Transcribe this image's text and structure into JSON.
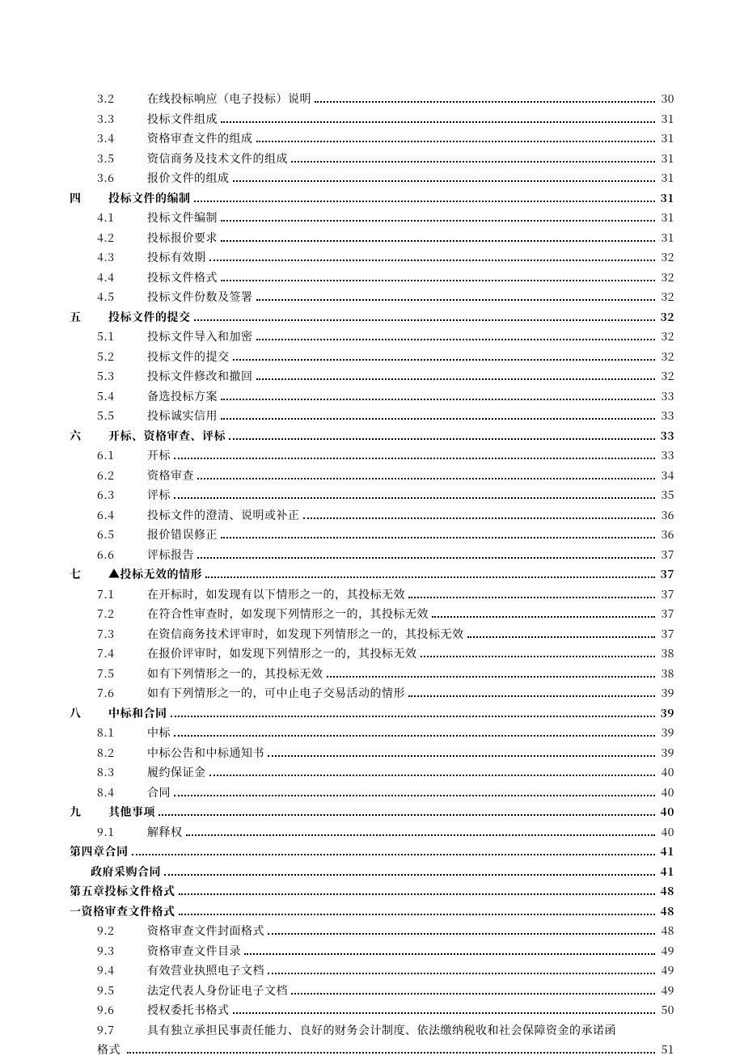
{
  "toc": [
    {
      "cls": "lvl-sub",
      "num": "3.2",
      "title": "在线投标响应（电子投标）说明",
      "page": "30"
    },
    {
      "cls": "lvl-sub",
      "num": "3.3",
      "title": "投标文件组成",
      "page": "31"
    },
    {
      "cls": "lvl-sub",
      "num": "3.4",
      "title": "资格审查文件的组成",
      "page": "31"
    },
    {
      "cls": "lvl-sub",
      "num": "3.5",
      "title": "资信商务及技术文件的组成",
      "page": "31"
    },
    {
      "cls": "lvl-sub",
      "num": "3.6",
      "title": "报价文件的组成",
      "page": "31"
    },
    {
      "cls": "lvl-sec",
      "num": "四",
      "title": "投标文件的编制 ",
      "page": "31"
    },
    {
      "cls": "lvl-sub",
      "num": "4.1",
      "title": "投标文件编制",
      "page": "31"
    },
    {
      "cls": "lvl-sub",
      "num": "4.2",
      "title": "投标报价要求",
      "page": "31"
    },
    {
      "cls": "lvl-sub",
      "num": "4.3",
      "title": "投标有效期",
      "page": "32"
    },
    {
      "cls": "lvl-sub",
      "num": "4.4",
      "title": "投标文件格式",
      "page": "32"
    },
    {
      "cls": "lvl-sub",
      "num": "4.5",
      "title": "投标文件份数及签署",
      "page": "32"
    },
    {
      "cls": "lvl-sec",
      "num": "五",
      "title": "投标文件的提交 ",
      "page": "32"
    },
    {
      "cls": "lvl-sub",
      "num": "5.1",
      "title": "投标文件导入和加密",
      "page": "32"
    },
    {
      "cls": "lvl-sub",
      "num": "5.2",
      "title": "投标文件的提交",
      "page": "32"
    },
    {
      "cls": "lvl-sub",
      "num": "5.3",
      "title": "投标文件修改和撤回",
      "page": "32"
    },
    {
      "cls": "lvl-sub",
      "num": "5.4",
      "title": "备选投标方案",
      "page": "33"
    },
    {
      "cls": "lvl-sub",
      "num": "5.5",
      "title": "投标诚实信用",
      "page": "33"
    },
    {
      "cls": "lvl-sec",
      "num": "六",
      "title": "开标、资格审查、评标 ",
      "page": "33"
    },
    {
      "cls": "lvl-sub",
      "num": "6.1",
      "title": "开标",
      "page": "33"
    },
    {
      "cls": "lvl-sub",
      "num": "6.2",
      "title": "资格审查",
      "page": "34"
    },
    {
      "cls": "lvl-sub",
      "num": "6.3",
      "title": "评标",
      "page": "35"
    },
    {
      "cls": "lvl-sub",
      "num": "6.4",
      "title": "投标文件的澄清、说明或补正",
      "page": "36"
    },
    {
      "cls": "lvl-sub",
      "num": "6.5",
      "title": "报价错误修正",
      "page": "36"
    },
    {
      "cls": "lvl-sub",
      "num": "6.6",
      "title": "评标报告",
      "page": "37"
    },
    {
      "cls": "lvl-sec",
      "num": "七",
      "title": "▲投标无效的情形 ",
      "page": "37"
    },
    {
      "cls": "lvl-sub",
      "num": "7.1",
      "title": "在开标时，如发现有以下情形之一的，其投标无效",
      "page": "37"
    },
    {
      "cls": "lvl-sub",
      "num": "7.2",
      "title": "在符合性审查时，如发现下列情形之一的，其投标无效",
      "page": "37"
    },
    {
      "cls": "lvl-sub",
      "num": "7.3",
      "title": "在资信商务技术评审时，如发现下列情形之一的，其投标无效",
      "page": "37"
    },
    {
      "cls": "lvl-sub",
      "num": "7.4",
      "title": "在报价评审时，如发现下列情形之一的，其投标无效",
      "page": "38"
    },
    {
      "cls": "lvl-sub",
      "num": "7.5",
      "title": "如有下列情形之一的，其投标无效",
      "page": "38"
    },
    {
      "cls": "lvl-sub",
      "num": "7.6",
      "title": "如有下列情形之一的，可中止电子交易活动的情形",
      "page": "39"
    },
    {
      "cls": "lvl-sec",
      "num": "八",
      "title": "中标和合同",
      "page": "39"
    },
    {
      "cls": "lvl-sub",
      "num": "8.1",
      "title": "中标 ",
      "page": "39"
    },
    {
      "cls": "lvl-sub",
      "num": "8.2",
      "title": "中标公告和中标通知书",
      "page": "39"
    },
    {
      "cls": "lvl-sub",
      "num": "8.3",
      "title": "履约保证金",
      "page": "40"
    },
    {
      "cls": "lvl-sub",
      "num": "8.4",
      "title": "合同",
      "page": "40"
    },
    {
      "cls": "lvl-sec",
      "num": "九",
      "title": "其他事项 ",
      "page": "40"
    },
    {
      "cls": "lvl-sub",
      "num": "9.1",
      "title": "解释权",
      "page": "40"
    },
    {
      "cls": "lvl-chap",
      "num": "",
      "title": "第四章合同 ",
      "page": "41"
    },
    {
      "cls": "lvl-misc",
      "num": "",
      "title": "政府采购合同 ",
      "page": "41"
    },
    {
      "cls": "lvl-chap",
      "num": "",
      "title": "第五章投标文件格式 ",
      "page": "48"
    },
    {
      "cls": "lvl-chap",
      "num": "",
      "title": "一资格审查文件格式 ",
      "page": "48"
    },
    {
      "cls": "lvl-sub",
      "num": "9.2",
      "title": "资格审查文件封面格式",
      "page": "48"
    },
    {
      "cls": "lvl-sub",
      "num": "9.3",
      "title": "资格审查文件目录",
      "page": "49"
    },
    {
      "cls": "lvl-sub",
      "num": "9.4",
      "title": "有效营业执照电子文档",
      "page": "49"
    },
    {
      "cls": "lvl-sub",
      "num": "9.5",
      "title": "法定代表人身份证电子文档 ",
      "page": "49"
    },
    {
      "cls": "lvl-sub",
      "num": "9.6",
      "title": "授权委托书格式",
      "page": "50"
    },
    {
      "cls": "lvl-cont-wrap",
      "num": "9.7",
      "title": "具有独立承担民事责任能力、良好的财务会计制度、依法缴纳税收和社会保障资金的承诺函",
      "cont": "格式 ",
      "page": "51"
    }
  ]
}
